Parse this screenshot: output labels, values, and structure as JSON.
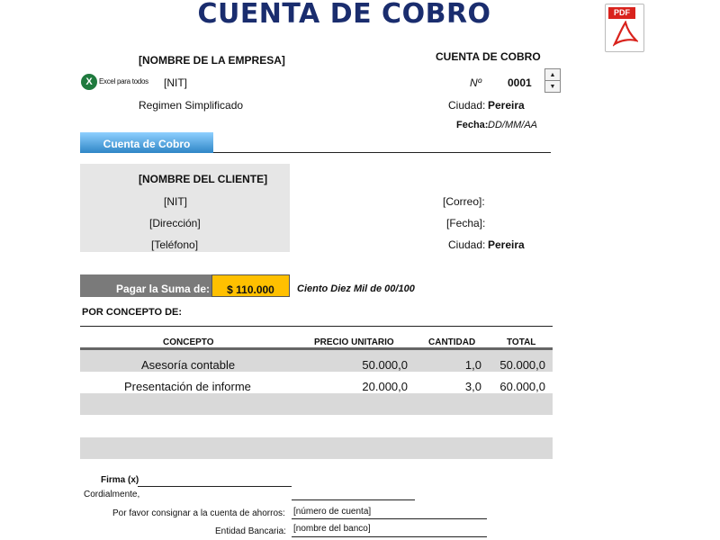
{
  "title": "CUENTA DE COBRO",
  "pdf_label": "PDF",
  "company": {
    "name": "[NOMBRE DE LA EMPRESA]",
    "nit": "[NIT]",
    "regime": "Regimen Simplificado",
    "logo_text": "Excel para todos",
    "logo_letter": "X"
  },
  "header_right": {
    "doc_title": "CUENTA DE COBRO",
    "number_label": "Nº",
    "number_value": "0001",
    "city_label": "Ciudad:",
    "city_value": "Pereira",
    "date_label": "Fecha:",
    "date_value": "DD/MM/AA"
  },
  "tab_label": "Cuenta de Cobro",
  "client": {
    "name": "[NOMBRE DEL CLIENTE]",
    "nit": "[NIT]",
    "address": "[Dirección]",
    "phone": "[Teléfono]",
    "email_label": "[Correo]:",
    "date_label": "[Fecha]:",
    "city_label": "Ciudad:",
    "city_value": "Pereira"
  },
  "payment": {
    "label": "Pagar la Suma de:",
    "amount": "$ 110.000",
    "in_words": "Ciento Diez Mil de  00/100"
  },
  "concept_heading": "POR CONCEPTO DE:",
  "table": {
    "headers": [
      "CONCEPTO",
      "PRECIO UNITARIO",
      "CANTIDAD",
      "TOTAL"
    ],
    "rows": [
      [
        "Asesoría contable",
        "50.000,0",
        "1,0",
        "50.000,0"
      ],
      [
        "Presentación de informe",
        "20.000,0",
        "3,0",
        "60.000,0"
      ],
      [
        "",
        "",
        "",
        ""
      ],
      [
        "",
        "",
        "",
        ""
      ],
      [
        "",
        "",
        "",
        ""
      ]
    ]
  },
  "footer": {
    "signature_label": "Firma (x)",
    "closing": "Cordialmente,",
    "account_label": "Por favor consignar a la cuenta de ahorros:",
    "account_value": "[número de cuenta]",
    "bank_label": "Entidad Bancaria:",
    "bank_value": "[nombre del banco]"
  },
  "colors": {
    "title": "#1a2d6e",
    "tab_gradient_top": "#8fd0ff",
    "tab_gradient_bottom": "#2f86c6",
    "client_box": "#e6e6e6",
    "pay_label_bg": "#7a7a7a",
    "pay_amount_bg": "#ffc000",
    "table_band": "#d9d9d9",
    "pdf_red": "#d9231d",
    "logo_green": "#1f7a3e"
  }
}
